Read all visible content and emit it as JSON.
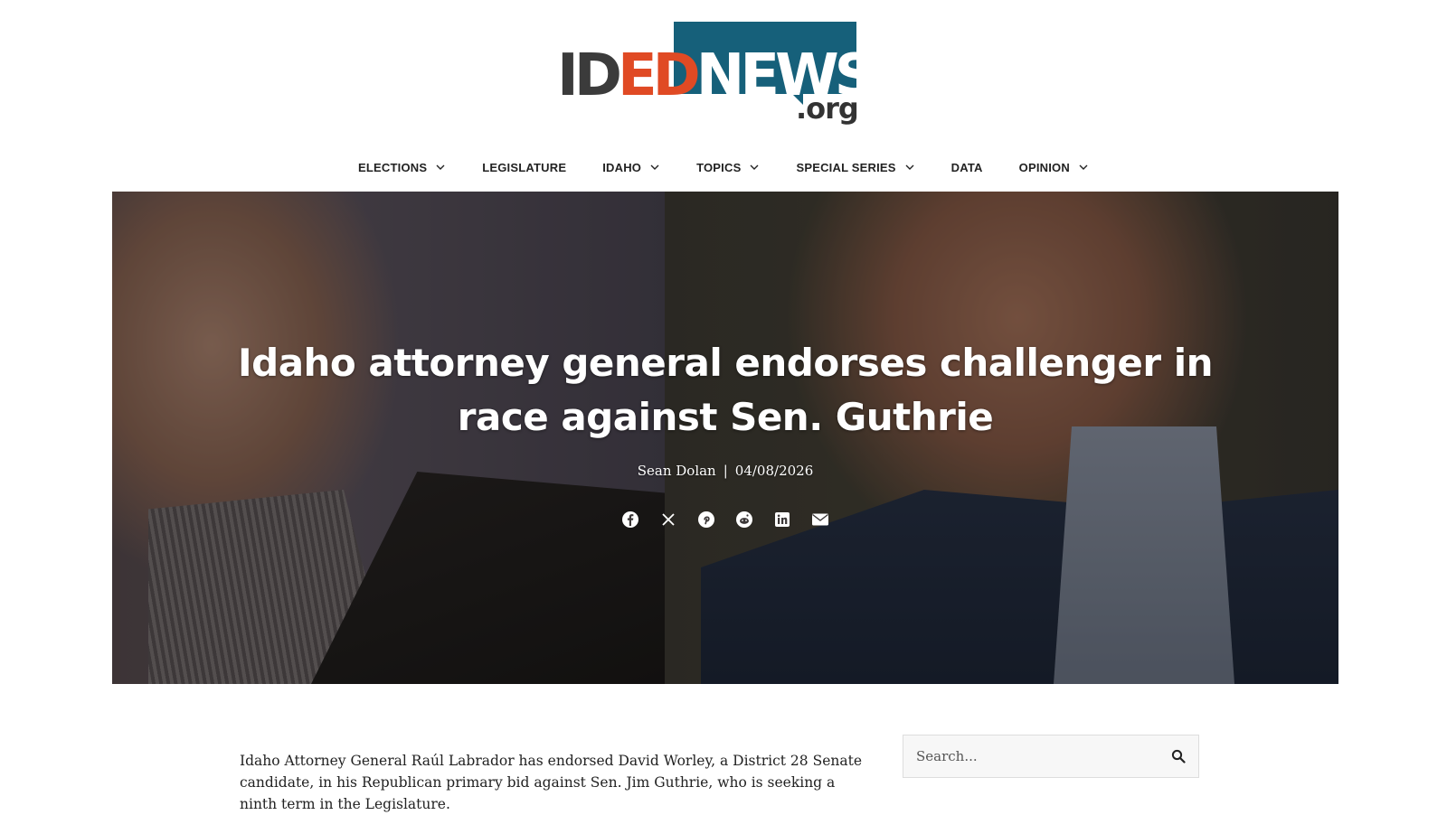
{
  "logo": {
    "part_id": "ID",
    "part_ed": "ED",
    "part_news": "NEWS",
    "part_org": ".org"
  },
  "nav": {
    "items": [
      {
        "label": "ELECTIONS",
        "has_dropdown": true
      },
      {
        "label": "LEGISLATURE",
        "has_dropdown": false
      },
      {
        "label": "IDAHO",
        "has_dropdown": true
      },
      {
        "label": "TOPICS",
        "has_dropdown": true
      },
      {
        "label": "SPECIAL SERIES",
        "has_dropdown": true
      },
      {
        "label": "DATA",
        "has_dropdown": false
      },
      {
        "label": "OPINION",
        "has_dropdown": true
      }
    ]
  },
  "article": {
    "title": "Idaho attorney general endorses challenger in race against Sen. Guthrie",
    "author": "Sean Dolan",
    "separator": "|",
    "date": "04/08/2026",
    "share_icons": [
      "facebook-icon",
      "x-icon",
      "pinterest-icon",
      "reddit-icon",
      "linkedin-icon",
      "email-icon"
    ],
    "body_paragraph": "Idaho Attorney General Raúl Labrador has endorsed David Worley, a District 28 Senate candidate, in his Republican primary bid against Sen. Jim Guthrie, who is seeking a ninth term in the Legislature."
  },
  "sidebar": {
    "search_placeholder": "Search..."
  },
  "colors": {
    "brand_teal": "#16607a",
    "brand_orange": "#e04a24",
    "brand_dark": "#3b3b3b"
  }
}
